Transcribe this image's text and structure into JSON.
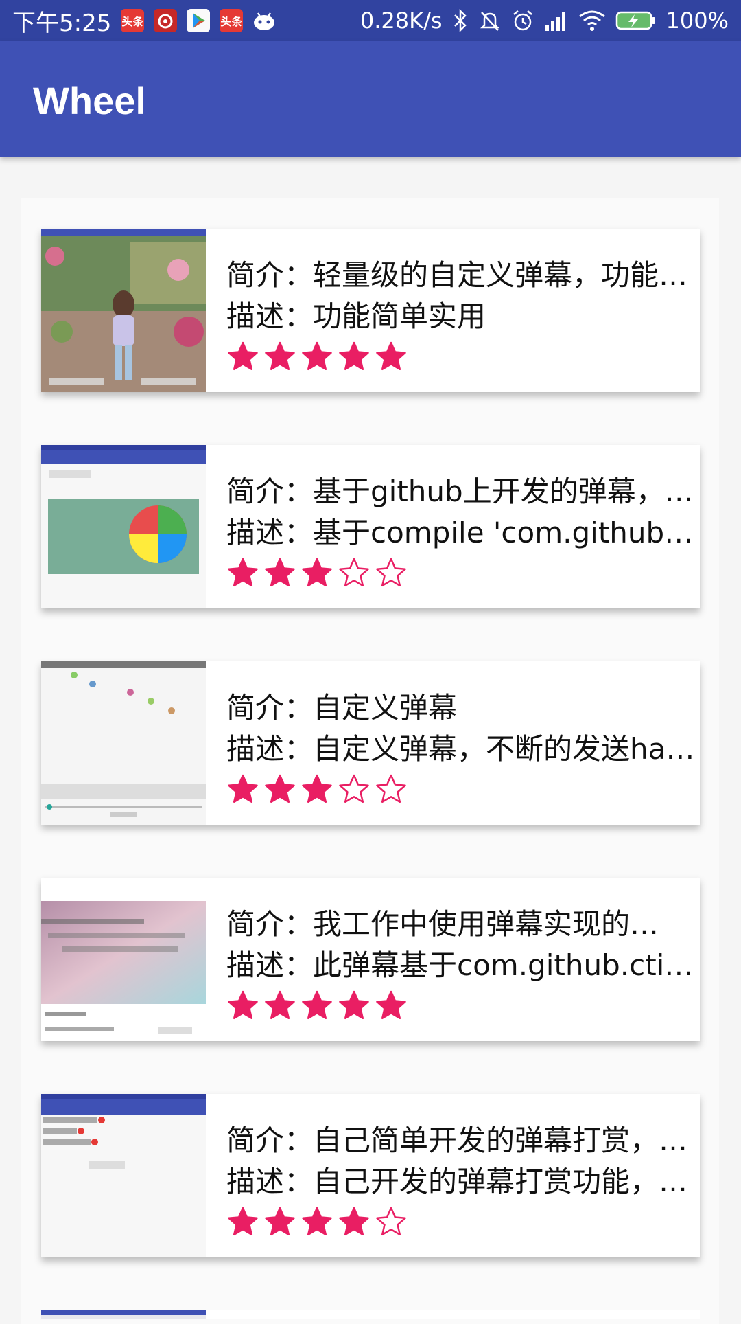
{
  "status_bar": {
    "time": "下午5:25",
    "speed": "0.28K/s",
    "battery": "100%",
    "icons": [
      "toutiao-icon",
      "weibo-icon",
      "play-store-icon",
      "toutiao-icon",
      "android-icon",
      "bluetooth-icon",
      "mute-icon",
      "alarm-icon",
      "signal-icon",
      "wifi-icon",
      "battery-icon"
    ],
    "toutiao_label": "头条"
  },
  "app_bar": {
    "title": "Wheel"
  },
  "colors": {
    "primary": "#3f51b5",
    "primary_dark": "#3143a0",
    "accent": "#e91e63"
  },
  "items": [
    {
      "intro": "简介：轻量级的自定义弹幕，功能…",
      "desc": "描述：功能简单实用",
      "rating": 5
    },
    {
      "intro": "简介：基于github上开发的弹幕，…",
      "desc": "描述：基于compile 'com.github.c…",
      "rating": 3
    },
    {
      "intro": "简介：自定义弹幕",
      "desc": "描述：自定义弹幕，不断的发送ha…",
      "rating": 3
    },
    {
      "intro": "简介：我工作中使用弹幕实现的…",
      "desc": "描述：此弹幕基于com.github.cti…",
      "rating": 5
    },
    {
      "intro": "简介：自己简单开发的弹幕打赏，…",
      "desc": "描述：自己开发的弹幕打赏功能，…",
      "rating": 4
    }
  ]
}
